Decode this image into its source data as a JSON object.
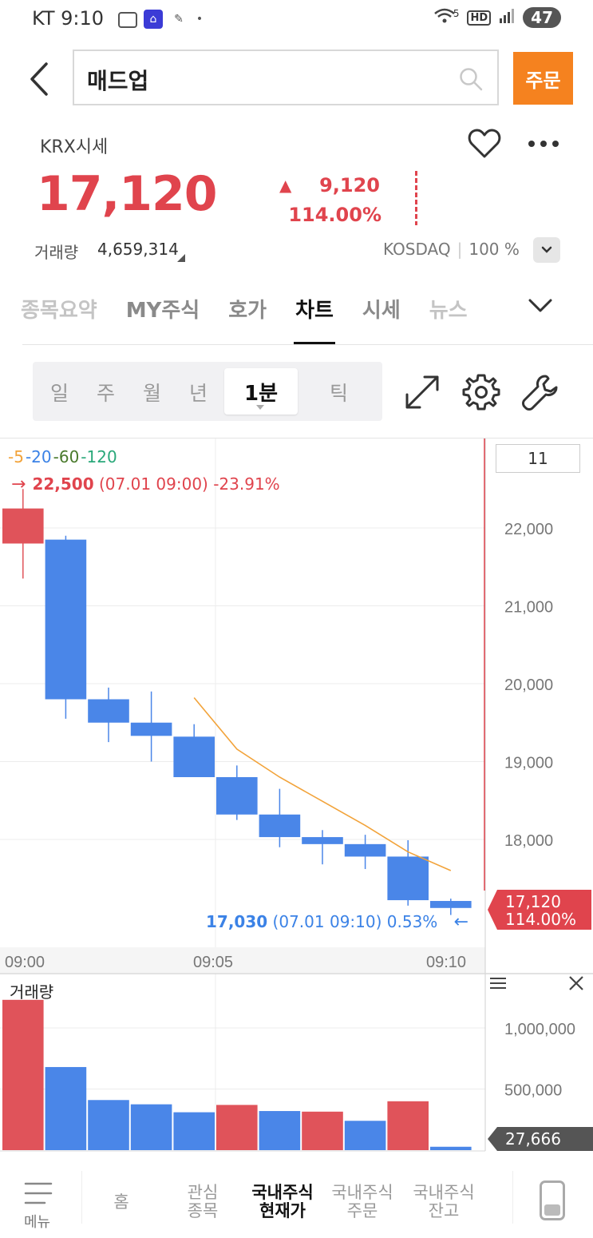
{
  "status_bar": {
    "carrier_time": "KT 9:10",
    "network_badge": "5",
    "hd_badge": "HD",
    "battery": "47"
  },
  "header": {
    "search_query": "매드업",
    "order_button": "주문"
  },
  "quote": {
    "source": "KRX시세",
    "price": "17,120",
    "change": "9,120",
    "change_pct": "114.00%",
    "volume_label": "거래량",
    "volume": "4,659,314",
    "market": "KOSDAQ",
    "ratio": "100 %"
  },
  "tabs": [
    "종목요약",
    "MY주식",
    "호가",
    "차트",
    "시세",
    "뉴스"
  ],
  "active_tab": "차트",
  "intervals": [
    "일",
    "주",
    "월",
    "년",
    "1분",
    "틱"
  ],
  "active_interval": "1분",
  "chart": {
    "ma_legend": [
      {
        "label": "-5",
        "color": "#f2a33a"
      },
      {
        "label": "-20",
        "color": "#3b82e6"
      },
      {
        "label": "-60",
        "color": "#4a7a2c"
      },
      {
        "label": "-120",
        "color": "#2aa87a"
      }
    ],
    "period_input": "11",
    "high_note": {
      "arrow": "→",
      "price": "22,500",
      "info": "(07.01 09:00) -23.91%"
    },
    "low_note": {
      "price": "17,030",
      "info": "(07.01 09:10) 0.53%",
      "arrow": "←"
    },
    "price_tag": {
      "price": "17,120",
      "pct": "114.00%"
    },
    "volume_panel_label": "거래량",
    "volume_tag": "27,666"
  },
  "chart_data": [
    {
      "type": "candlestick",
      "title": "",
      "x": [
        "09:00",
        "09:01",
        "09:02",
        "09:03",
        "09:04",
        "09:05",
        "09:06",
        "09:07",
        "09:08",
        "09:09",
        "09:10"
      ],
      "x_tick_labels": [
        "09:00",
        "09:05",
        "09:10"
      ],
      "y_tick_labels": [
        "22,000",
        "21,000",
        "20,000",
        "19,000",
        "18,000"
      ],
      "ylim": [
        16900,
        23000
      ],
      "candles": [
        {
          "open": 21800,
          "high": 22500,
          "low": 21350,
          "close": 22250
        },
        {
          "open": 21850,
          "high": 21900,
          "low": 19550,
          "close": 19800
        },
        {
          "open": 19800,
          "high": 19950,
          "low": 19250,
          "close": 19500
        },
        {
          "open": 19500,
          "high": 19900,
          "low": 19000,
          "close": 19330
        },
        {
          "open": 19320,
          "high": 19480,
          "low": 18800,
          "close": 18800
        },
        {
          "open": 18800,
          "high": 18950,
          "low": 18250,
          "close": 18320
        },
        {
          "open": 18320,
          "high": 18650,
          "low": 17900,
          "close": 18030
        },
        {
          "open": 18030,
          "high": 18120,
          "low": 17680,
          "close": 17940
        },
        {
          "open": 17940,
          "high": 18060,
          "low": 17620,
          "close": 17780
        },
        {
          "open": 17780,
          "high": 17990,
          "low": 17150,
          "close": 17220
        },
        {
          "open": 17210,
          "high": 17240,
          "low": 17030,
          "close": 17120
        }
      ],
      "series": [
        {
          "name": "5",
          "color": "#f2a33a",
          "values": [
            null,
            null,
            null,
            null,
            19820,
            19160,
            18800,
            18490,
            18180,
            17840,
            17600
          ]
        }
      ],
      "grid": true
    },
    {
      "type": "bar",
      "title": "",
      "ylabel": "거래량",
      "categories": [
        "09:00",
        "09:01",
        "09:02",
        "09:03",
        "09:04",
        "09:05",
        "09:06",
        "09:07",
        "09:08",
        "09:09",
        "09:10"
      ],
      "values": [
        1230000,
        680000,
        410000,
        375000,
        310000,
        370000,
        320000,
        315000,
        240000,
        400000,
        27666
      ],
      "colors": [
        "#e0535a",
        "#4a86e8",
        "#4a86e8",
        "#4a86e8",
        "#4a86e8",
        "#e0535a",
        "#4a86e8",
        "#e0535a",
        "#4a86e8",
        "#e0535a",
        "#4a86e8"
      ],
      "y_tick_labels": [
        "1,000,000",
        "500,000"
      ],
      "ylim": [
        0,
        1300000
      ]
    }
  ],
  "bottom_nav": {
    "menu_label": "메뉴",
    "items": [
      {
        "label": "홈"
      },
      {
        "label": "관심\n종목"
      },
      {
        "label": "국내주식\n현재가"
      },
      {
        "label": "국내주식\n주문"
      },
      {
        "label": "국내주식\n잔고"
      }
    ],
    "active_item": "국내주식\n현재가"
  }
}
